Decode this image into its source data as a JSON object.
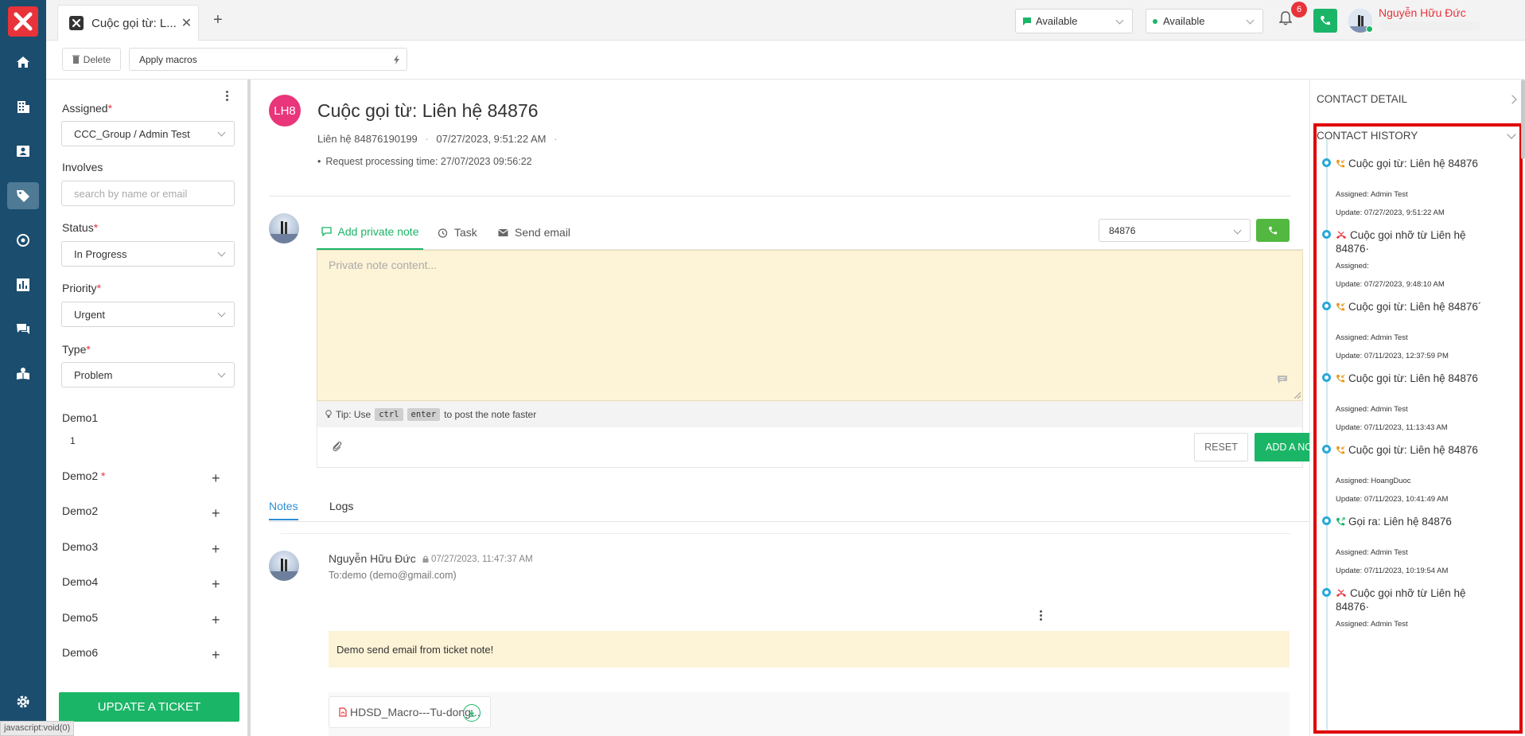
{
  "colors": {
    "brand_red": "#e8333a",
    "nav_bg": "#1b4d6e",
    "green": "#1bb567",
    "highlight_frame": "#e00000"
  },
  "nav": {
    "items": [
      {
        "icon": "home-icon",
        "active": false
      },
      {
        "icon": "building-icon",
        "active": false
      },
      {
        "icon": "contact-card-icon",
        "active": false
      },
      {
        "icon": "ticket-tag-icon",
        "active": true
      },
      {
        "icon": "settings-circle-icon",
        "active": false
      },
      {
        "icon": "bar-chart-icon",
        "active": false
      },
      {
        "icon": "chat-icon",
        "active": false
      },
      {
        "icon": "knowledge-base-icon",
        "active": false
      }
    ],
    "bottom_icon": "gear-icon"
  },
  "topbar": {
    "tab_title": "Cuộc gọi từ: L...",
    "status_chat": "Available",
    "status_call": "Available",
    "notification_count": "6",
    "user_name": "Nguyễn Hữu Đức"
  },
  "actionbar": {
    "delete_label": "Delete",
    "macros_label": "Apply macros"
  },
  "form": {
    "assigned_label": "Assigned",
    "assigned_value": "CCC_Group / Admin Test",
    "involves_label": "Involves",
    "involves_placeholder": "search by name or email",
    "status_label": "Status",
    "status_value": "In Progress",
    "priority_label": "Priority",
    "priority_value": "Urgent",
    "type_label": "Type",
    "type_value": "Problem",
    "demo1_label": "Demo1",
    "demo1_value": "1",
    "demo_fields": [
      {
        "label": "Demo2",
        "required": true
      },
      {
        "label": "Demo2",
        "required": false
      },
      {
        "label": "Demo3",
        "required": false
      },
      {
        "label": "Demo4",
        "required": false
      },
      {
        "label": "Demo5",
        "required": false
      },
      {
        "label": "Demo6",
        "required": false
      }
    ],
    "update_button": "UPDATE A TICKET"
  },
  "ticket": {
    "avatar_initials": "LH8",
    "title": "Cuộc gọi từ: Liên hệ 84876",
    "contact": "Liên hệ 84876190199",
    "datetime": "07/27/2023, 9:51:22 AM",
    "request_processing": "Request processing time: 27/07/2023 09:56:22"
  },
  "editor": {
    "tabs": [
      {
        "label": "Add private note",
        "icon": "note-icon",
        "active": true
      },
      {
        "label": "Task",
        "icon": "alarm-clock-icon",
        "active": false
      },
      {
        "label": "Send email",
        "icon": "envelope-icon",
        "active": false
      }
    ],
    "phone_value": "84876",
    "placeholder": "Private note content...",
    "tip_prefix": "Tip: Use",
    "tip_key1": "ctrl",
    "tip_key2": "enter",
    "tip_suffix": "to post the note faster",
    "reset_label": "RESET",
    "add_label": "ADD A NOTE"
  },
  "notes_tabs": {
    "notes": "Notes",
    "logs": "Logs"
  },
  "note": {
    "author": "Nguyễn Hữu Đức",
    "time": "07/27/2023, 11:47:37 AM",
    "to": "To:demo (demo@gmail.com)",
    "body": "Demo send email from ticket note!",
    "attachment": "HDSD_Macro---Tu-dong..."
  },
  "rightpanel": {
    "contact_detail": "CONTACT DETAIL",
    "contact_history": "CONTACT HISTORY",
    "history": [
      {
        "icon": "incoming-call-icon",
        "icon_color": "#e89a1c",
        "title": "Cuộc gọi từ: Liên hệ 84876",
        "assigned": "Assigned: Admin Test",
        "update": "Update: 07/27/2023, 9:51:22 AM"
      },
      {
        "icon": "missed-call-icon",
        "icon_color": "#e8333a",
        "title": "Cuộc gọi nhỡ từ Liên hệ 84876·",
        "assigned": "Assigned:",
        "update": "Update: 07/27/2023, 9:48:10 AM"
      },
      {
        "icon": "incoming-call-icon",
        "icon_color": "#e89a1c",
        "title": "Cuộc gọi từ: Liên hệ 84876´",
        "assigned": "Assigned: Admin Test",
        "update": "Update: 07/11/2023, 12:37:59 PM"
      },
      {
        "icon": "incoming-call-icon",
        "icon_color": "#e89a1c",
        "title": "Cuộc gọi từ: Liên hệ 84876",
        "assigned": "Assigned: Admin Test",
        "update": "Update: 07/11/2023, 11:13:43 AM"
      },
      {
        "icon": "incoming-call-icon",
        "icon_color": "#e89a1c",
        "title": "Cuộc gọi từ: Liên hệ 84876",
        "assigned": "Assigned: HoangDuoc",
        "update": "Update: 07/11/2023, 10:41:49 AM"
      },
      {
        "icon": "outgoing-call-icon",
        "icon_color": "#1bb567",
        "title": "Gọi ra: Liên hệ 84876",
        "assigned": "Assigned: Admin Test",
        "update": "Update: 07/11/2023, 10:19:54 AM"
      },
      {
        "icon": "missed-call-icon",
        "icon_color": "#e8333a",
        "title": "Cuộc gọi nhỡ từ Liên hệ 84876·",
        "assigned": "Assigned: Admin Test",
        "update": ""
      }
    ]
  },
  "statusbar": "javascript:void(0)"
}
